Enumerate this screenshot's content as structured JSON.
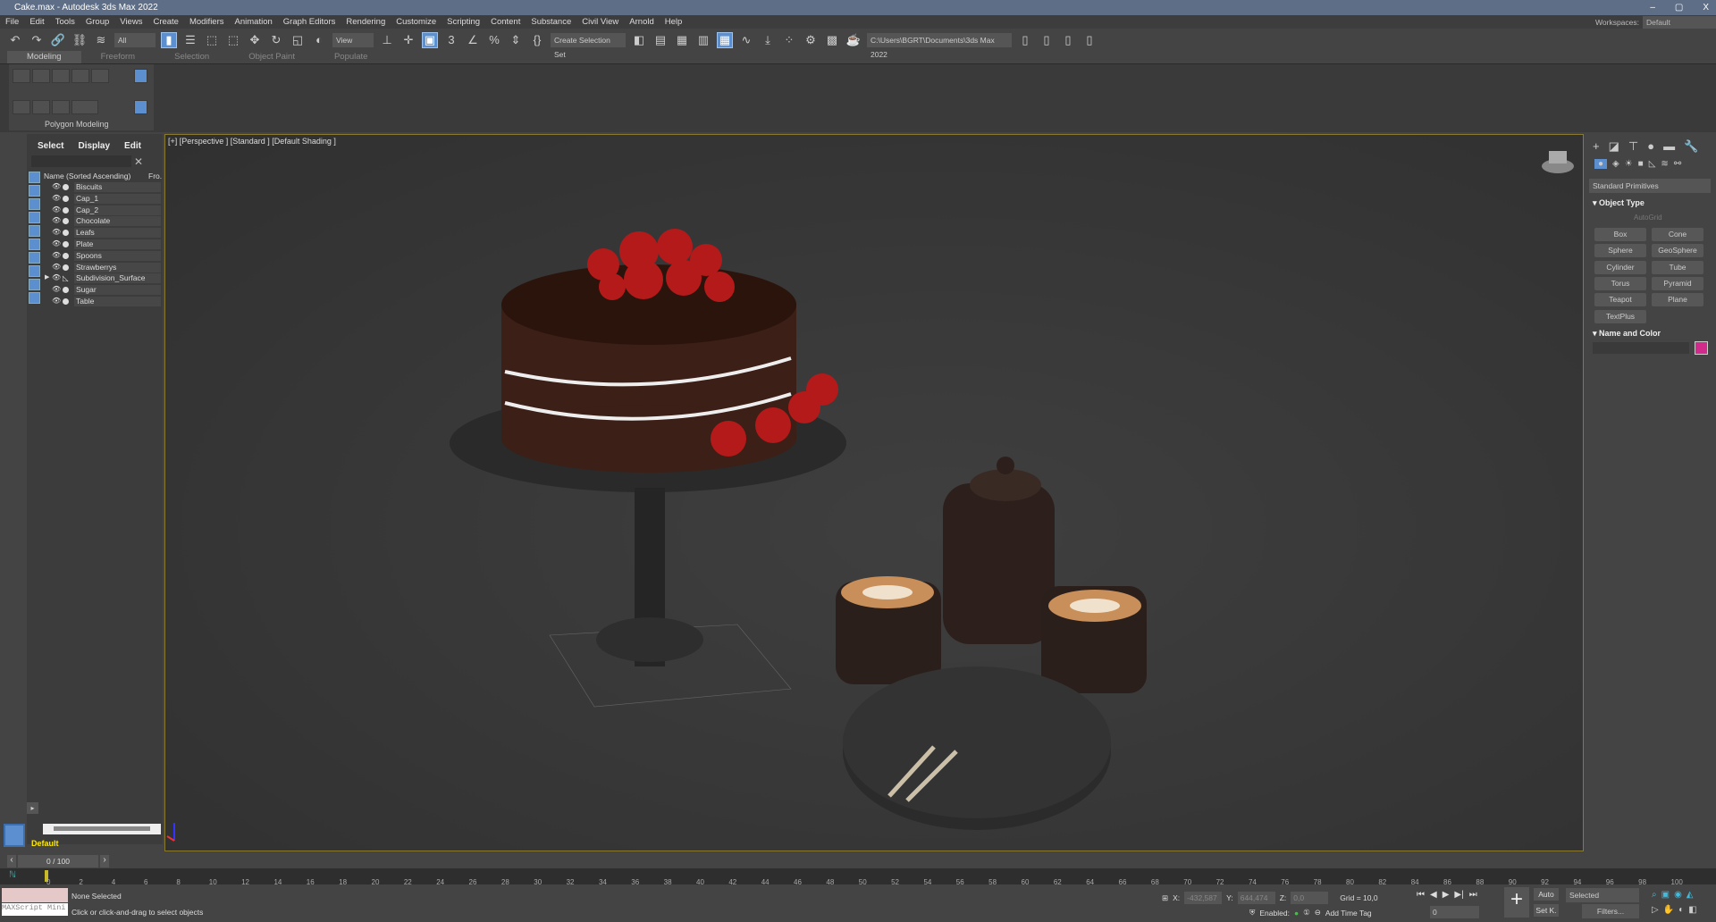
{
  "window": {
    "title": "Cake.max - Autodesk 3ds Max 2022",
    "controls": [
      "–",
      "▢",
      "X"
    ]
  },
  "menu": [
    "File",
    "Edit",
    "Tools",
    "Group",
    "Views",
    "Create",
    "Modifiers",
    "Animation",
    "Graph Editors",
    "Rendering",
    "Customize",
    "Scripting",
    "Content",
    "Substance",
    "Civil View",
    "Arnold",
    "Help"
  ],
  "workspaces": {
    "label": "Workspaces:",
    "value": "Default"
  },
  "toolbar": {
    "filter": "All",
    "ref_coord": "View",
    "selection_set": "Create Selection Set",
    "project_path": "C:\\Users\\BGRT\\Documents\\3ds Max 2022"
  },
  "ribbon": {
    "tabs": [
      "Modeling",
      "Freeform",
      "Selection",
      "Object Paint",
      "Populate"
    ],
    "panel_label": "Polygon Modeling"
  },
  "explorer": {
    "tabs": [
      "Select",
      "Display",
      "Edit"
    ],
    "column_header": "Name (Sorted Ascending)",
    "column2": "Fro.",
    "items": [
      "Biscuits",
      "Cap_1",
      "Cap_2",
      "Chocolate",
      "Leafs",
      "Plate",
      "Spoons",
      "Strawberrys",
      "Subdivision_Surface",
      "Sugar",
      "Table"
    ],
    "layer": "Default"
  },
  "viewport": {
    "label": "[+] [Perspective ] [Standard ] [Default Shading ]"
  },
  "command_panel": {
    "category": "Standard Primitives",
    "rollout1": "Object Type",
    "autogrid": "AutoGrid",
    "buttons": [
      "Box",
      "Cone",
      "Sphere",
      "GeoSphere",
      "Cylinder",
      "Tube",
      "Torus",
      "Pyramid",
      "Teapot",
      "Plane",
      "TextPlus"
    ],
    "rollout2": "Name and Color",
    "object_color": "#d02a8a"
  },
  "timeline": {
    "frame": "0 / 100",
    "ticks": [
      "0",
      "2",
      "4",
      "6",
      "8",
      "10",
      "12",
      "14",
      "16",
      "18",
      "20",
      "22",
      "24",
      "26",
      "28",
      "30",
      "32",
      "34",
      "36",
      "38",
      "40",
      "42",
      "44",
      "46",
      "48",
      "50",
      "52",
      "54",
      "56",
      "58",
      "60",
      "62",
      "64",
      "66",
      "68",
      "70",
      "72",
      "74",
      "76",
      "78",
      "80",
      "82",
      "84",
      "86",
      "88",
      "90",
      "92",
      "94",
      "96",
      "98",
      "100"
    ]
  },
  "status": {
    "maxscript": "MAXScript Mini",
    "selection": "None Selected",
    "prompt": "Click or click-and-drag to select objects",
    "x_label": "X:",
    "x": "-432,587",
    "y_label": "Y:",
    "y": "644,474",
    "z_label": "Z:",
    "z": "0,0",
    "grid": "Grid = 10,0",
    "enabled": "Enabled:",
    "add_time_tag": "Add Time Tag",
    "auto": "Auto",
    "setkey": "Set K.",
    "key_filter": "Selected",
    "filters": "Filters...",
    "current_frame": "0"
  }
}
